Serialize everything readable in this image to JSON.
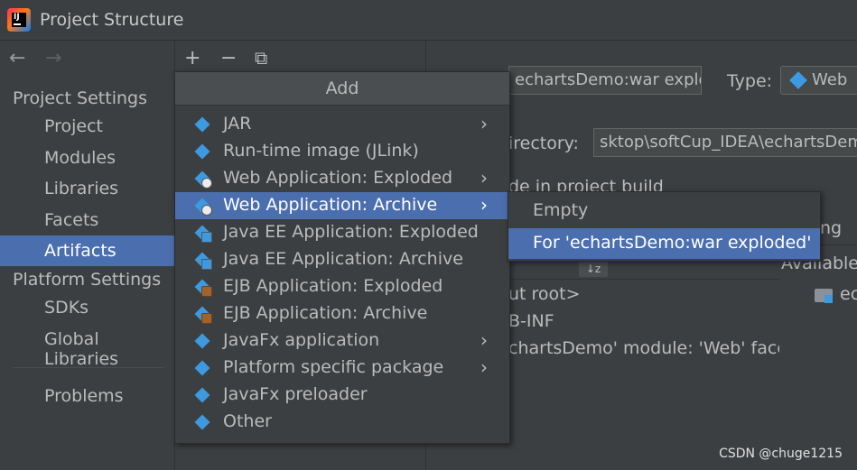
{
  "window": {
    "title": "Project Structure",
    "app_icon": "intellij-idea-icon"
  },
  "nav": {
    "back": "←",
    "forward": "→"
  },
  "sidebar": {
    "project_settings_header": "Project Settings",
    "project_items": [
      {
        "label": "Project"
      },
      {
        "label": "Modules"
      },
      {
        "label": "Libraries"
      },
      {
        "label": "Facets"
      },
      {
        "label": "Artifacts"
      }
    ],
    "platform_settings_header": "Platform Settings",
    "platform_items": [
      {
        "label": "SDKs"
      },
      {
        "label": "Global Libraries"
      }
    ],
    "problems": "Problems",
    "selected": "Artifacts"
  },
  "toolbar": {
    "add": "+",
    "remove": "−",
    "copy": "⧉"
  },
  "add_menu": {
    "header": "Add",
    "items": [
      {
        "label": "JAR",
        "submenu": true,
        "icon": "jar-icon"
      },
      {
        "label": "Run-time image (JLink)",
        "submenu": false,
        "icon": "runtime-image-icon"
      },
      {
        "label": "Web Application: Exploded",
        "submenu": true,
        "icon": "web-app-exploded-icon"
      },
      {
        "label": "Web Application: Archive",
        "submenu": true,
        "icon": "web-app-archive-icon",
        "active": true
      },
      {
        "label": "Java EE Application: Exploded",
        "submenu": false,
        "icon": "javaee-exploded-icon"
      },
      {
        "label": "Java EE Application: Archive",
        "submenu": false,
        "icon": "javaee-archive-icon"
      },
      {
        "label": "EJB Application: Exploded",
        "submenu": false,
        "icon": "ejb-exploded-icon"
      },
      {
        "label": "EJB Application: Archive",
        "submenu": false,
        "icon": "ejb-archive-icon"
      },
      {
        "label": "JavaFx application",
        "submenu": true,
        "icon": "javafx-app-icon"
      },
      {
        "label": "Platform specific package",
        "submenu": true,
        "icon": "platform-package-icon"
      },
      {
        "label": "JavaFx preloader",
        "submenu": false,
        "icon": "javafx-preloader-icon"
      },
      {
        "label": "Other",
        "submenu": false,
        "icon": "other-icon"
      }
    ],
    "submenu_arrow": "›"
  },
  "archive_submenu": {
    "items": [
      {
        "label": "Empty"
      },
      {
        "label": "For 'echartsDemo:war exploded'",
        "active": true
      }
    ]
  },
  "details": {
    "name_value": "echartsDemo:war explo",
    "type_label": "Type:",
    "type_value": "Web",
    "directory_label": "irectory:",
    "directory_value": "sktop\\softCup_IDEA\\echartsDemo",
    "include_in_build": "de in project build",
    "ng_fragment": "ng",
    "available_label": "Available",
    "tree": [
      {
        "label": "ut root>"
      },
      {
        "label": "B-INF"
      },
      {
        "label": "chartsDemo' module: 'Web' facet res"
      }
    ],
    "available_item": "ec"
  },
  "watermark": "CSDN @chuge1215"
}
